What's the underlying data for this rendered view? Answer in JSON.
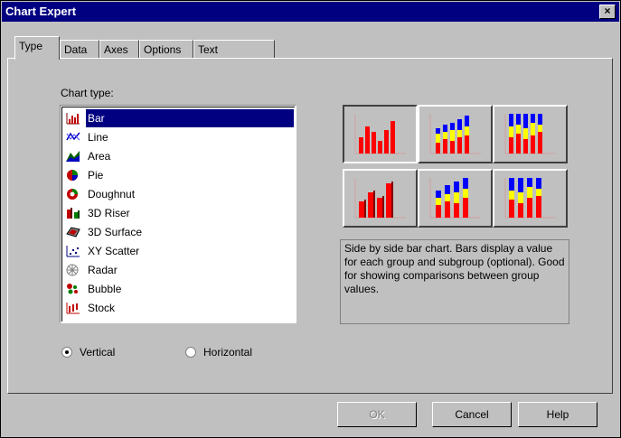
{
  "window": {
    "title": "Chart Expert",
    "close_glyph": "×"
  },
  "tabs": [
    {
      "label": "Type"
    },
    {
      "label": "Data"
    },
    {
      "label": "Axes"
    },
    {
      "label": "Options"
    },
    {
      "label": "Text"
    }
  ],
  "active_tab": "Type",
  "chart_type": {
    "label": "Chart type:",
    "items": [
      {
        "label": "Bar",
        "icon": "bar-chart-icon",
        "selected": true
      },
      {
        "label": "Line",
        "icon": "line-chart-icon"
      },
      {
        "label": "Area",
        "icon": "area-chart-icon"
      },
      {
        "label": "Pie",
        "icon": "pie-chart-icon"
      },
      {
        "label": "Doughnut",
        "icon": "doughnut-chart-icon"
      },
      {
        "label": "3D Riser",
        "icon": "3d-riser-icon"
      },
      {
        "label": "3D Surface",
        "icon": "3d-surface-icon"
      },
      {
        "label": "XY Scatter",
        "icon": "xy-scatter-icon"
      },
      {
        "label": "Radar",
        "icon": "radar-chart-icon"
      },
      {
        "label": "Bubble",
        "icon": "bubble-chart-icon"
      },
      {
        "label": "Stock",
        "icon": "stock-chart-icon"
      }
    ]
  },
  "orientation": {
    "vertical": {
      "label": "Vertical",
      "checked": true
    },
    "horizontal": {
      "label": "Horizontal",
      "checked": false
    }
  },
  "description": "Side by side bar chart. Bars display a value for each group and subgroup (optional). Good for showing comparisons between group values.",
  "buttons": {
    "ok": "OK",
    "cancel": "Cancel",
    "help": "Help"
  },
  "colors": {
    "title_bar": "#000080",
    "face": "#c0c0c0",
    "selection": "#000080",
    "bar_red": "#ff0000",
    "bar_yellow": "#ffff00",
    "bar_blue": "#0000ff"
  }
}
